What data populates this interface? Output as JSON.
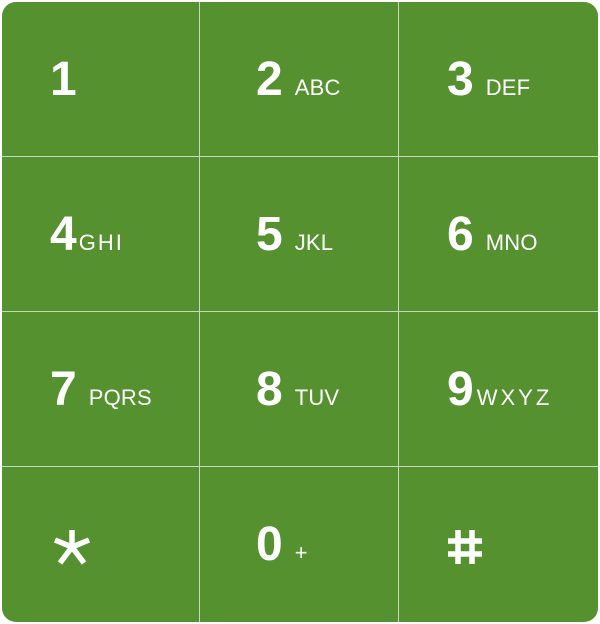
{
  "colors": {
    "key_background": "#55912f",
    "key_text": "#ffffff",
    "divider": "#c9d9bf"
  },
  "keys": [
    {
      "digit": "1",
      "letters": ""
    },
    {
      "digit": "2",
      "letters": "ABC"
    },
    {
      "digit": "3",
      "letters": "DEF"
    },
    {
      "digit": "4",
      "letters": "GHI"
    },
    {
      "digit": "5",
      "letters": "JKL"
    },
    {
      "digit": "6",
      "letters": "MNO"
    },
    {
      "digit": "7",
      "letters": "PQRS"
    },
    {
      "digit": "8",
      "letters": "TUV"
    },
    {
      "digit": "9",
      "letters": "WXYZ"
    },
    {
      "icon": "asterisk-icon"
    },
    {
      "digit": "0",
      "letters": "+"
    },
    {
      "icon": "hash-icon"
    }
  ]
}
